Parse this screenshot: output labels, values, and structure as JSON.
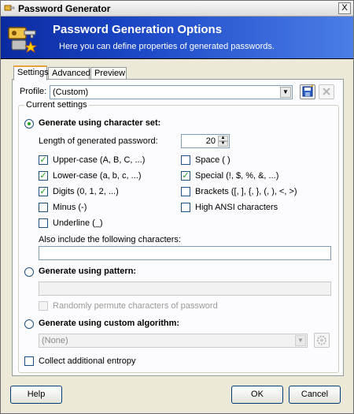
{
  "window": {
    "title": "Password Generator",
    "close": "X"
  },
  "banner": {
    "title": "Password Generation Options",
    "subtitle": "Here you can define properties of generated passwords."
  },
  "tabs": [
    "Settings",
    "Advanced",
    "Preview"
  ],
  "profile": {
    "label": "Profile:",
    "value": "(Custom)"
  },
  "group": {
    "legend": "Current settings"
  },
  "charset": {
    "label": "Generate using character set:",
    "checked": true,
    "length_label": "Length of generated password:",
    "length_value": "20",
    "options": [
      {
        "label": "Upper-case (A, B, C, ...)",
        "checked": true
      },
      {
        "label": "Lower-case (a, b, c, ...)",
        "checked": true
      },
      {
        "label": "Digits (0, 1, 2, ...)",
        "checked": true
      },
      {
        "label": "Minus (-)",
        "checked": false
      },
      {
        "label": "Underline (_)",
        "checked": false
      },
      {
        "label": "Space ( )",
        "checked": false
      },
      {
        "label": "Special (!, $, %, &, ...)",
        "checked": true
      },
      {
        "label": "Brackets ([, ], {, }, (, ), <, >)",
        "checked": false
      },
      {
        "label": "High ANSI characters",
        "checked": false
      }
    ],
    "also_include_label": "Also include the following characters:",
    "also_include_value": ""
  },
  "pattern": {
    "label": "Generate using pattern:",
    "value": "",
    "permute_label": "Randomly permute characters of password"
  },
  "custom": {
    "label": "Generate using custom algorithm:",
    "value": "(None)"
  },
  "entropy": {
    "label": "Collect additional entropy"
  },
  "buttons": {
    "help": "Help",
    "ok": "OK",
    "cancel": "Cancel"
  },
  "colors": {
    "banner_start": "#0a2aa0",
    "banner_end": "#4b7ee6",
    "check_mark": "#21a121"
  },
  "icons": [
    "keys-icon",
    "save-icon",
    "delete-icon",
    "gear-icon"
  ]
}
